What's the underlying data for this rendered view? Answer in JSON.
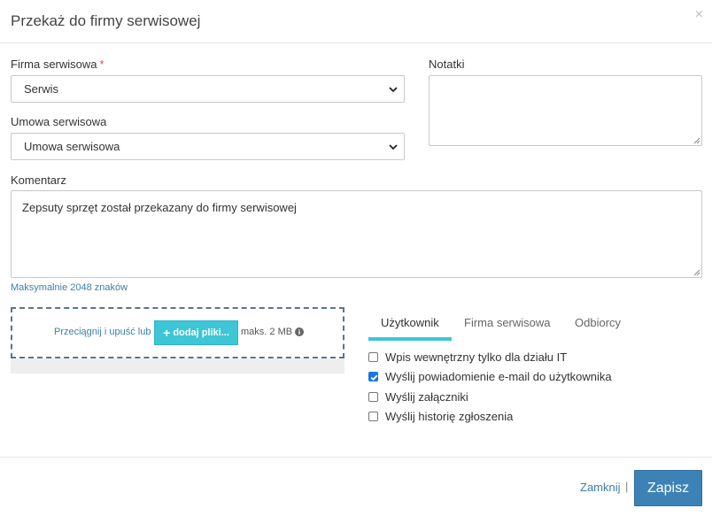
{
  "modal": {
    "title": "Przekaż do firmy serwisowej",
    "close_symbol": "×"
  },
  "form": {
    "service_company": {
      "label": "Firma serwisowa",
      "required_mark": "*",
      "value": "Serwis"
    },
    "service_contract": {
      "label": "Umowa serwisowa",
      "value": "Umowa serwisowa"
    },
    "notes": {
      "label": "Notatki",
      "value": ""
    },
    "comment": {
      "label": "Komentarz",
      "value": "Zepsuty sprzęt został przekazany do firmy serwisowej",
      "hint": "Maksymalnie 2048 znaków"
    }
  },
  "upload": {
    "drag_text": "Przeciągnij i upuść lub",
    "button_label": "dodaj pliki...",
    "max_size": "maks. 2 MB",
    "button_icon": "plus-icon",
    "info_icon": "info-icon"
  },
  "tabs": [
    {
      "label": "Użytkownik",
      "active": true
    },
    {
      "label": "Firma serwisowa",
      "active": false
    },
    {
      "label": "Odbiorcy",
      "active": false
    }
  ],
  "checkboxes": [
    {
      "label": "Wpis wewnętrzny tylko dla działu IT",
      "checked": false
    },
    {
      "label": "Wyślij powiadomienie e-mail do użytkownika",
      "checked": true
    },
    {
      "label": "Wyślij załączniki",
      "checked": false
    },
    {
      "label": "Wyślij historię zgłoszenia",
      "checked": false
    }
  ],
  "footer": {
    "close_label": "Zamknij",
    "separator": "|",
    "save_label": "Zapisz"
  },
  "colors": {
    "accent": "#3cc6d6",
    "primary_button": "#3d82b7",
    "link": "#3d7fa8",
    "required": "#d9534f",
    "checkbox_checked": "#1a73e8"
  }
}
